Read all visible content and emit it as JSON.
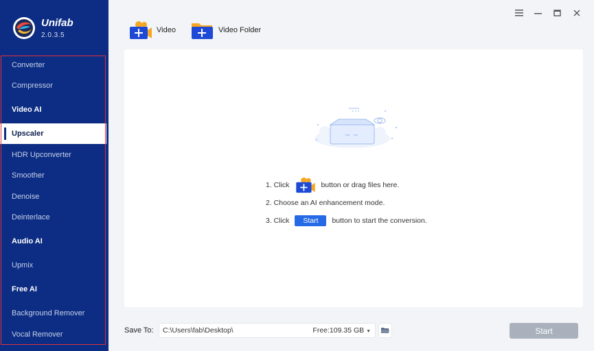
{
  "app": {
    "name": "Unifab",
    "version": "2.0.3.5"
  },
  "sidebar": {
    "items": [
      {
        "label": "Converter",
        "kind": "item"
      },
      {
        "label": "Compressor",
        "kind": "item"
      },
      {
        "label": "Video AI",
        "kind": "header"
      },
      {
        "label": "Upscaler",
        "kind": "item",
        "active": true
      },
      {
        "label": "HDR Upconverter",
        "kind": "item"
      },
      {
        "label": "Smoother",
        "kind": "item"
      },
      {
        "label": "Denoise",
        "kind": "item"
      },
      {
        "label": "Deinterlace",
        "kind": "item"
      },
      {
        "label": "Audio AI",
        "kind": "header"
      },
      {
        "label": "Upmix",
        "kind": "item"
      },
      {
        "label": "Free AI",
        "kind": "header"
      },
      {
        "label": "Background Remover",
        "kind": "item"
      },
      {
        "label": "Vocal Remover",
        "kind": "item"
      }
    ]
  },
  "toolbar": {
    "add_video_label": "Video",
    "add_folder_label": "Video Folder"
  },
  "instructions": {
    "step1_prefix": "1. Click",
    "step1_suffix": "button or drag files here.",
    "step2": "2. Choose an AI enhancement mode.",
    "step3_prefix": "3. Click",
    "step3_button": "Start",
    "step3_suffix": "button to start the conversion."
  },
  "bottom": {
    "save_to_label": "Save To:",
    "path": "C:\\Users\\fab\\Desktop\\",
    "free_space": "Free:109.35 GB",
    "start_label": "Start"
  },
  "colors": {
    "sidebar_bg": "#0c2d83",
    "accent_blue": "#2569e6",
    "highlight_red": "#e0323c",
    "disabled_button": "#aab1bd"
  }
}
